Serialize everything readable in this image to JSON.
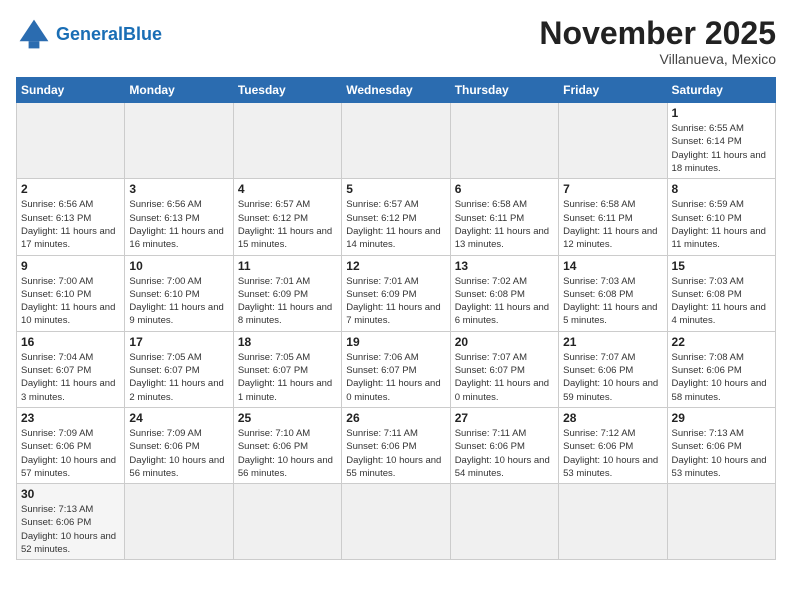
{
  "header": {
    "logo_general": "General",
    "logo_blue": "Blue",
    "month_title": "November 2025",
    "location": "Villanueva, Mexico"
  },
  "days_of_week": [
    "Sunday",
    "Monday",
    "Tuesday",
    "Wednesday",
    "Thursday",
    "Friday",
    "Saturday"
  ],
  "weeks": [
    [
      {
        "day": "",
        "empty": true
      },
      {
        "day": "",
        "empty": true
      },
      {
        "day": "",
        "empty": true
      },
      {
        "day": "",
        "empty": true
      },
      {
        "day": "",
        "empty": true
      },
      {
        "day": "",
        "empty": true
      },
      {
        "day": "1",
        "sunrise": "Sunrise: 6:55 AM",
        "sunset": "Sunset: 6:14 PM",
        "daylight": "Daylight: 11 hours and 18 minutes."
      }
    ],
    [
      {
        "day": "2",
        "sunrise": "Sunrise: 6:56 AM",
        "sunset": "Sunset: 6:13 PM",
        "daylight": "Daylight: 11 hours and 17 minutes."
      },
      {
        "day": "3",
        "sunrise": "Sunrise: 6:56 AM",
        "sunset": "Sunset: 6:13 PM",
        "daylight": "Daylight: 11 hours and 16 minutes."
      },
      {
        "day": "4",
        "sunrise": "Sunrise: 6:57 AM",
        "sunset": "Sunset: 6:12 PM",
        "daylight": "Daylight: 11 hours and 15 minutes."
      },
      {
        "day": "5",
        "sunrise": "Sunrise: 6:57 AM",
        "sunset": "Sunset: 6:12 PM",
        "daylight": "Daylight: 11 hours and 14 minutes."
      },
      {
        "day": "6",
        "sunrise": "Sunrise: 6:58 AM",
        "sunset": "Sunset: 6:11 PM",
        "daylight": "Daylight: 11 hours and 13 minutes."
      },
      {
        "day": "7",
        "sunrise": "Sunrise: 6:58 AM",
        "sunset": "Sunset: 6:11 PM",
        "daylight": "Daylight: 11 hours and 12 minutes."
      },
      {
        "day": "8",
        "sunrise": "Sunrise: 6:59 AM",
        "sunset": "Sunset: 6:10 PM",
        "daylight": "Daylight: 11 hours and 11 minutes."
      }
    ],
    [
      {
        "day": "9",
        "sunrise": "Sunrise: 7:00 AM",
        "sunset": "Sunset: 6:10 PM",
        "daylight": "Daylight: 11 hours and 10 minutes."
      },
      {
        "day": "10",
        "sunrise": "Sunrise: 7:00 AM",
        "sunset": "Sunset: 6:10 PM",
        "daylight": "Daylight: 11 hours and 9 minutes."
      },
      {
        "day": "11",
        "sunrise": "Sunrise: 7:01 AM",
        "sunset": "Sunset: 6:09 PM",
        "daylight": "Daylight: 11 hours and 8 minutes."
      },
      {
        "day": "12",
        "sunrise": "Sunrise: 7:01 AM",
        "sunset": "Sunset: 6:09 PM",
        "daylight": "Daylight: 11 hours and 7 minutes."
      },
      {
        "day": "13",
        "sunrise": "Sunrise: 7:02 AM",
        "sunset": "Sunset: 6:08 PM",
        "daylight": "Daylight: 11 hours and 6 minutes."
      },
      {
        "day": "14",
        "sunrise": "Sunrise: 7:03 AM",
        "sunset": "Sunset: 6:08 PM",
        "daylight": "Daylight: 11 hours and 5 minutes."
      },
      {
        "day": "15",
        "sunrise": "Sunrise: 7:03 AM",
        "sunset": "Sunset: 6:08 PM",
        "daylight": "Daylight: 11 hours and 4 minutes."
      }
    ],
    [
      {
        "day": "16",
        "sunrise": "Sunrise: 7:04 AM",
        "sunset": "Sunset: 6:07 PM",
        "daylight": "Daylight: 11 hours and 3 minutes."
      },
      {
        "day": "17",
        "sunrise": "Sunrise: 7:05 AM",
        "sunset": "Sunset: 6:07 PM",
        "daylight": "Daylight: 11 hours and 2 minutes."
      },
      {
        "day": "18",
        "sunrise": "Sunrise: 7:05 AM",
        "sunset": "Sunset: 6:07 PM",
        "daylight": "Daylight: 11 hours and 1 minute."
      },
      {
        "day": "19",
        "sunrise": "Sunrise: 7:06 AM",
        "sunset": "Sunset: 6:07 PM",
        "daylight": "Daylight: 11 hours and 0 minutes."
      },
      {
        "day": "20",
        "sunrise": "Sunrise: 7:07 AM",
        "sunset": "Sunset: 6:07 PM",
        "daylight": "Daylight: 11 hours and 0 minutes."
      },
      {
        "day": "21",
        "sunrise": "Sunrise: 7:07 AM",
        "sunset": "Sunset: 6:06 PM",
        "daylight": "Daylight: 10 hours and 59 minutes."
      },
      {
        "day": "22",
        "sunrise": "Sunrise: 7:08 AM",
        "sunset": "Sunset: 6:06 PM",
        "daylight": "Daylight: 10 hours and 58 minutes."
      }
    ],
    [
      {
        "day": "23",
        "sunrise": "Sunrise: 7:09 AM",
        "sunset": "Sunset: 6:06 PM",
        "daylight": "Daylight: 10 hours and 57 minutes."
      },
      {
        "day": "24",
        "sunrise": "Sunrise: 7:09 AM",
        "sunset": "Sunset: 6:06 PM",
        "daylight": "Daylight: 10 hours and 56 minutes."
      },
      {
        "day": "25",
        "sunrise": "Sunrise: 7:10 AM",
        "sunset": "Sunset: 6:06 PM",
        "daylight": "Daylight: 10 hours and 56 minutes."
      },
      {
        "day": "26",
        "sunrise": "Sunrise: 7:11 AM",
        "sunset": "Sunset: 6:06 PM",
        "daylight": "Daylight: 10 hours and 55 minutes."
      },
      {
        "day": "27",
        "sunrise": "Sunrise: 7:11 AM",
        "sunset": "Sunset: 6:06 PM",
        "daylight": "Daylight: 10 hours and 54 minutes."
      },
      {
        "day": "28",
        "sunrise": "Sunrise: 7:12 AM",
        "sunset": "Sunset: 6:06 PM",
        "daylight": "Daylight: 10 hours and 53 minutes."
      },
      {
        "day": "29",
        "sunrise": "Sunrise: 7:13 AM",
        "sunset": "Sunset: 6:06 PM",
        "daylight": "Daylight: 10 hours and 53 minutes."
      }
    ],
    [
      {
        "day": "30",
        "sunrise": "Sunrise: 7:13 AM",
        "sunset": "Sunset: 6:06 PM",
        "daylight": "Daylight: 10 hours and 52 minutes."
      },
      {
        "day": "",
        "empty": true
      },
      {
        "day": "",
        "empty": true
      },
      {
        "day": "",
        "empty": true
      },
      {
        "day": "",
        "empty": true
      },
      {
        "day": "",
        "empty": true
      },
      {
        "day": "",
        "empty": true
      }
    ]
  ]
}
